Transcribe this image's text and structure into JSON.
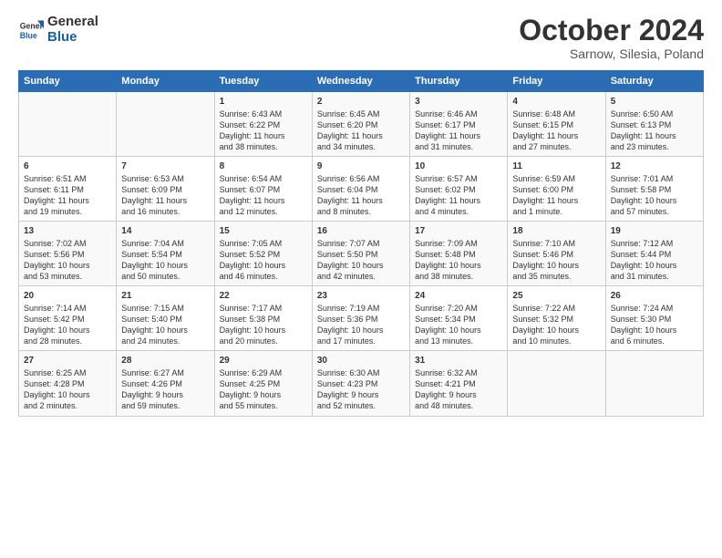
{
  "logo": {
    "line1": "General",
    "line2": "Blue"
  },
  "title": "October 2024",
  "subtitle": "Sarnow, Silesia, Poland",
  "days_header": [
    "Sunday",
    "Monday",
    "Tuesday",
    "Wednesday",
    "Thursday",
    "Friday",
    "Saturday"
  ],
  "weeks": [
    [
      {
        "day": "",
        "info": ""
      },
      {
        "day": "",
        "info": ""
      },
      {
        "day": "1",
        "info": "Sunrise: 6:43 AM\nSunset: 6:22 PM\nDaylight: 11 hours\nand 38 minutes."
      },
      {
        "day": "2",
        "info": "Sunrise: 6:45 AM\nSunset: 6:20 PM\nDaylight: 11 hours\nand 34 minutes."
      },
      {
        "day": "3",
        "info": "Sunrise: 6:46 AM\nSunset: 6:17 PM\nDaylight: 11 hours\nand 31 minutes."
      },
      {
        "day": "4",
        "info": "Sunrise: 6:48 AM\nSunset: 6:15 PM\nDaylight: 11 hours\nand 27 minutes."
      },
      {
        "day": "5",
        "info": "Sunrise: 6:50 AM\nSunset: 6:13 PM\nDaylight: 11 hours\nand 23 minutes."
      }
    ],
    [
      {
        "day": "6",
        "info": "Sunrise: 6:51 AM\nSunset: 6:11 PM\nDaylight: 11 hours\nand 19 minutes."
      },
      {
        "day": "7",
        "info": "Sunrise: 6:53 AM\nSunset: 6:09 PM\nDaylight: 11 hours\nand 16 minutes."
      },
      {
        "day": "8",
        "info": "Sunrise: 6:54 AM\nSunset: 6:07 PM\nDaylight: 11 hours\nand 12 minutes."
      },
      {
        "day": "9",
        "info": "Sunrise: 6:56 AM\nSunset: 6:04 PM\nDaylight: 11 hours\nand 8 minutes."
      },
      {
        "day": "10",
        "info": "Sunrise: 6:57 AM\nSunset: 6:02 PM\nDaylight: 11 hours\nand 4 minutes."
      },
      {
        "day": "11",
        "info": "Sunrise: 6:59 AM\nSunset: 6:00 PM\nDaylight: 11 hours\nand 1 minute."
      },
      {
        "day": "12",
        "info": "Sunrise: 7:01 AM\nSunset: 5:58 PM\nDaylight: 10 hours\nand 57 minutes."
      }
    ],
    [
      {
        "day": "13",
        "info": "Sunrise: 7:02 AM\nSunset: 5:56 PM\nDaylight: 10 hours\nand 53 minutes."
      },
      {
        "day": "14",
        "info": "Sunrise: 7:04 AM\nSunset: 5:54 PM\nDaylight: 10 hours\nand 50 minutes."
      },
      {
        "day": "15",
        "info": "Sunrise: 7:05 AM\nSunset: 5:52 PM\nDaylight: 10 hours\nand 46 minutes."
      },
      {
        "day": "16",
        "info": "Sunrise: 7:07 AM\nSunset: 5:50 PM\nDaylight: 10 hours\nand 42 minutes."
      },
      {
        "day": "17",
        "info": "Sunrise: 7:09 AM\nSunset: 5:48 PM\nDaylight: 10 hours\nand 38 minutes."
      },
      {
        "day": "18",
        "info": "Sunrise: 7:10 AM\nSunset: 5:46 PM\nDaylight: 10 hours\nand 35 minutes."
      },
      {
        "day": "19",
        "info": "Sunrise: 7:12 AM\nSunset: 5:44 PM\nDaylight: 10 hours\nand 31 minutes."
      }
    ],
    [
      {
        "day": "20",
        "info": "Sunrise: 7:14 AM\nSunset: 5:42 PM\nDaylight: 10 hours\nand 28 minutes."
      },
      {
        "day": "21",
        "info": "Sunrise: 7:15 AM\nSunset: 5:40 PM\nDaylight: 10 hours\nand 24 minutes."
      },
      {
        "day": "22",
        "info": "Sunrise: 7:17 AM\nSunset: 5:38 PM\nDaylight: 10 hours\nand 20 minutes."
      },
      {
        "day": "23",
        "info": "Sunrise: 7:19 AM\nSunset: 5:36 PM\nDaylight: 10 hours\nand 17 minutes."
      },
      {
        "day": "24",
        "info": "Sunrise: 7:20 AM\nSunset: 5:34 PM\nDaylight: 10 hours\nand 13 minutes."
      },
      {
        "day": "25",
        "info": "Sunrise: 7:22 AM\nSunset: 5:32 PM\nDaylight: 10 hours\nand 10 minutes."
      },
      {
        "day": "26",
        "info": "Sunrise: 7:24 AM\nSunset: 5:30 PM\nDaylight: 10 hours\nand 6 minutes."
      }
    ],
    [
      {
        "day": "27",
        "info": "Sunrise: 6:25 AM\nSunset: 4:28 PM\nDaylight: 10 hours\nand 2 minutes."
      },
      {
        "day": "28",
        "info": "Sunrise: 6:27 AM\nSunset: 4:26 PM\nDaylight: 9 hours\nand 59 minutes."
      },
      {
        "day": "29",
        "info": "Sunrise: 6:29 AM\nSunset: 4:25 PM\nDaylight: 9 hours\nand 55 minutes."
      },
      {
        "day": "30",
        "info": "Sunrise: 6:30 AM\nSunset: 4:23 PM\nDaylight: 9 hours\nand 52 minutes."
      },
      {
        "day": "31",
        "info": "Sunrise: 6:32 AM\nSunset: 4:21 PM\nDaylight: 9 hours\nand 48 minutes."
      },
      {
        "day": "",
        "info": ""
      },
      {
        "day": "",
        "info": ""
      }
    ]
  ]
}
